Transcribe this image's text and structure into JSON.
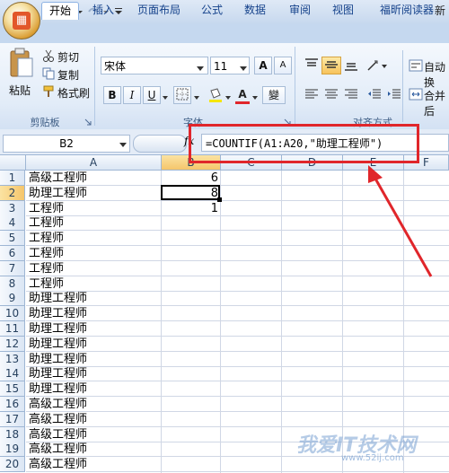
{
  "title_right": "新",
  "tabs": [
    {
      "label": "开始",
      "active": true
    },
    {
      "label": "插入",
      "active": false
    },
    {
      "label": "页面布局",
      "active": false
    },
    {
      "label": "公式",
      "active": false
    },
    {
      "label": "数据",
      "active": false
    },
    {
      "label": "审阅",
      "active": false
    },
    {
      "label": "视图",
      "active": false
    },
    {
      "label": "福昕阅读器",
      "active": false
    }
  ],
  "clipboard": {
    "paste": "粘贴",
    "cut": "剪切",
    "copy": "复制",
    "format_painter": "格式刷",
    "group": "剪贴板"
  },
  "font": {
    "name": "宋体",
    "size": "11",
    "group": "字体",
    "bold": "B",
    "italic": "I",
    "underline": "U",
    "font_color": "A",
    "wen": "變"
  },
  "alignment": {
    "group": "对齐方式",
    "wrap": "自动换",
    "merge": "合并后"
  },
  "formula_bar": {
    "name_box": "B2",
    "fx": "fx",
    "formula": "=COUNTIF(A1:A20,\"助理工程师\")"
  },
  "columns": [
    "A",
    "B",
    "C",
    "D",
    "E",
    "F"
  ],
  "rows": [
    {
      "n": "1",
      "a": "高级工程师",
      "b": "6"
    },
    {
      "n": "2",
      "a": "助理工程师",
      "b": "8"
    },
    {
      "n": "3",
      "a": "工程师",
      "b": "1"
    },
    {
      "n": "4",
      "a": "工程师",
      "b": ""
    },
    {
      "n": "5",
      "a": "工程师",
      "b": ""
    },
    {
      "n": "6",
      "a": "工程师",
      "b": ""
    },
    {
      "n": "7",
      "a": "工程师",
      "b": ""
    },
    {
      "n": "8",
      "a": "工程师",
      "b": ""
    },
    {
      "n": "9",
      "a": "助理工程师",
      "b": ""
    },
    {
      "n": "10",
      "a": "助理工程师",
      "b": ""
    },
    {
      "n": "11",
      "a": "助理工程师",
      "b": ""
    },
    {
      "n": "12",
      "a": "助理工程师",
      "b": ""
    },
    {
      "n": "13",
      "a": "助理工程师",
      "b": ""
    },
    {
      "n": "14",
      "a": "助理工程师",
      "b": ""
    },
    {
      "n": "15",
      "a": "助理工程师",
      "b": ""
    },
    {
      "n": "16",
      "a": "高级工程师",
      "b": ""
    },
    {
      "n": "17",
      "a": "高级工程师",
      "b": ""
    },
    {
      "n": "18",
      "a": "高级工程师",
      "b": ""
    },
    {
      "n": "19",
      "a": "高级工程师",
      "b": ""
    },
    {
      "n": "20",
      "a": "高级工程师",
      "b": ""
    }
  ],
  "watermark": {
    "text": "我爱IT技术网",
    "url": "www.52ij.com"
  },
  "colors": {
    "annotation": "#e0262b",
    "selection": "#000000",
    "ribbon": "#dfe9f6"
  }
}
